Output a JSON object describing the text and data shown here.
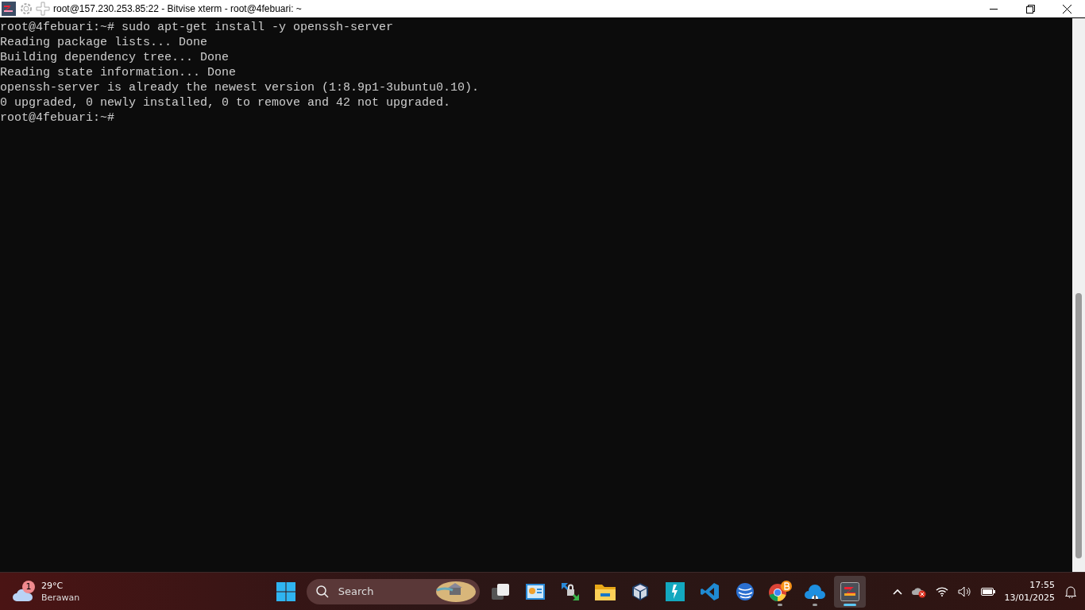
{
  "window": {
    "title": "root@157.230.253.85:22 - Bitvise xterm - root@4febuari: ~"
  },
  "terminal": {
    "lines": [
      "root@4febuari:~# sudo apt-get install -y openssh-server",
      "Reading package lists... Done",
      "Building dependency tree... Done",
      "Reading state information... Done",
      "openssh-server is already the newest version (1:8.9p1-3ubuntu0.10).",
      "0 upgraded, 0 newly installed, 0 to remove and 42 not upgraded.",
      "root@4febuari:~#"
    ]
  },
  "taskbar": {
    "weather": {
      "badge": "1",
      "temperature": "29°C",
      "condition": "Berawan"
    },
    "search": {
      "placeholder": "Search"
    },
    "apps": [
      {
        "kind": "taskview",
        "running": false,
        "active": false
      },
      {
        "kind": "panel",
        "running": false,
        "active": false
      },
      {
        "kind": "lock",
        "running": false,
        "active": false
      },
      {
        "kind": "folder",
        "running": false,
        "active": false
      },
      {
        "kind": "cube",
        "running": false,
        "active": false
      },
      {
        "kind": "bolt",
        "running": false,
        "active": false
      },
      {
        "kind": "code",
        "running": false,
        "active": false
      },
      {
        "kind": "globe",
        "running": false,
        "active": false
      },
      {
        "kind": "chrome",
        "running": true,
        "active": false
      },
      {
        "kind": "cloud",
        "running": true,
        "active": false
      },
      {
        "kind": "terminal",
        "running": true,
        "active": true
      }
    ],
    "clock": {
      "time": "17:55",
      "date": "13/01/2025"
    }
  }
}
